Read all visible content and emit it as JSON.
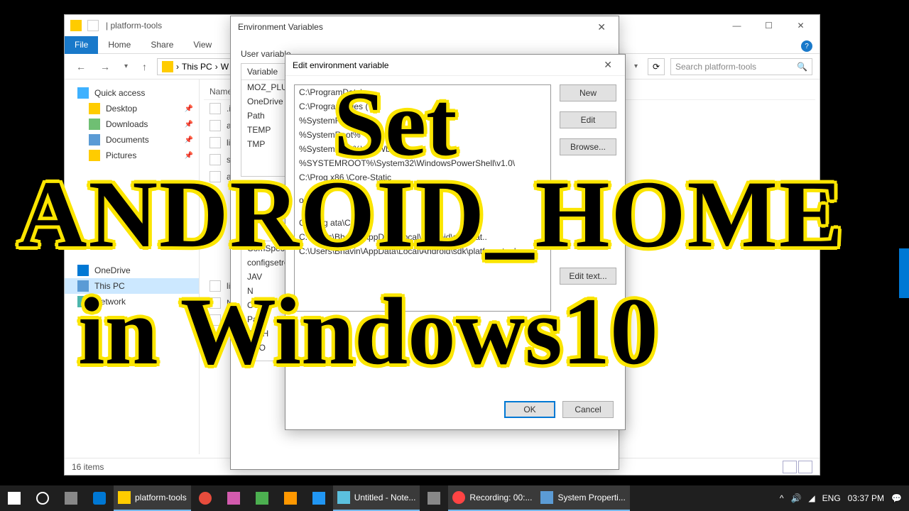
{
  "explorer": {
    "title": "| platform-tools",
    "ribbon": {
      "file": "File",
      "tabs": [
        "Home",
        "Share",
        "View"
      ]
    },
    "breadcrumb": [
      "This PC",
      "W"
    ],
    "search_placeholder": "Search platform-tools",
    "nav": {
      "quick": "Quick access",
      "items": [
        "Desktop",
        "Downloads",
        "Documents",
        "Pictures"
      ],
      "onedrive": "OneDrive",
      "thispc": "This PC",
      "network": "Network"
    },
    "files_header": "Name",
    "files": [
      ".ins",
      "api",
      "lib6",
      "sys",
      "adb",
      "libw",
      "NO",
      "pac"
    ],
    "status": "16 items"
  },
  "envdlg": {
    "title": "Environment Variables",
    "user_section": "User variable",
    "col_variable": "Variable",
    "user_vars": [
      "MOZ_PLUG",
      "OneDrive",
      "Path",
      "TEMP",
      "TMP"
    ],
    "sys_vars": [
      "ComSpec",
      "configsetro",
      "JAV",
      "N",
      "OS",
      "Pat",
      "PATH",
      "PRO"
    ],
    "ok": "OK",
    "cancel": "Cancel"
  },
  "editdlg": {
    "title": "Edit environment variable",
    "paths": [
      "C:\\ProgramData\\",
      "C:\\Program Files (",
      "%SystemRoot%\\",
      "%SystemRoot%",
      "%SystemRoot%\\Sy        \\Wbem",
      "%SYSTEMROOT%\\System32\\WindowsPowerShell\\v1.0\\",
      "C:\\Prog            x86                    \\Core-Static",
      "",
      "",
      "                                                      on\\",
      "",
      "",
      "C:\\Prog      ata\\Comp",
      "C:\\Users\\Bhavin\\AppData\\Local\\Android\\sdk\\plat..",
      "C:\\Users\\Bhavin\\AppData\\Local\\Android\\sdk\\platform-tools"
    ],
    "buttons": {
      "new": "New",
      "edit": "Edit",
      "browse": "Browse...",
      "edit_text": "Edit text..."
    },
    "ok": "OK",
    "cancel": "Cancel"
  },
  "overlay": {
    "l1": "Set",
    "l2": "ANDROID_HOME",
    "l3": "in Windows10"
  },
  "taskbar": {
    "apps": [
      {
        "label": "platform-tools"
      },
      {
        "label": "Untitled - Note..."
      },
      {
        "label": "Recording:  00:..."
      },
      {
        "label": "System Properti..."
      }
    ],
    "lang": "ENG",
    "time": "03:37 PM"
  }
}
